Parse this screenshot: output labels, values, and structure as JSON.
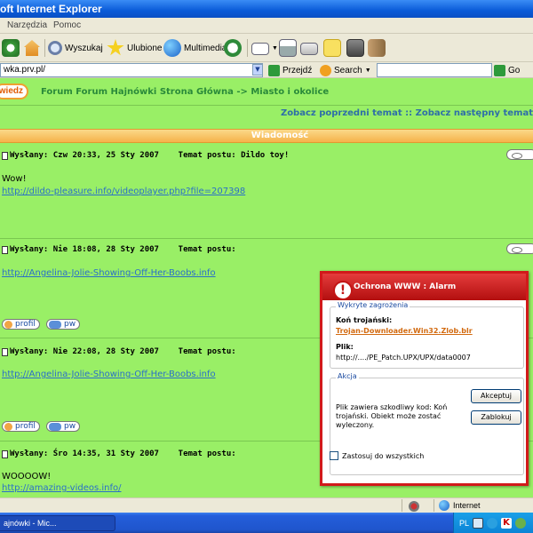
{
  "window": {
    "title": "oft Internet Explorer"
  },
  "menu": {
    "items": [
      "Narzędzia",
      "Pomoc"
    ]
  },
  "toolbar": {
    "search_label": "Wyszukaj",
    "favorites_label": "Ulubione",
    "multimedia_label": "Multimedia"
  },
  "address": {
    "url": "wka.prv.pl/",
    "go_label": "Przejdź",
    "search_label": "Search",
    "go2_label": "Go"
  },
  "forum": {
    "login_label": "wiedz",
    "path": "Forum Forum Hajnówki Strona Główna -> Miasto i okolice",
    "topic_nav": "Zobacz poprzedni temat :: Zobacz następny temat",
    "header": "Wiadomość"
  },
  "posts": [
    {
      "header": "Wysłany: Czw 20:33, 25 Sty 2007    Temat postu: Dildo toy!",
      "body": "Wow!",
      "link": "http://dildo-pleasure.info/videoplayer.php?file=207398"
    },
    {
      "header": "Wysłany: Nie 18:08, 28 Sty 2007    Temat postu:",
      "body": "",
      "link": "http://Angelina-Jolie-Showing-Off-Her-Boobs.info"
    },
    {
      "header": "Wysłany: Nie 22:08, 28 Sty 2007    Temat postu:",
      "body": "",
      "link": "http://Angelina-Jolie-Showing-Off-Her-Boobs.info"
    },
    {
      "header": "Wysłany: Śro 14:35, 31 Sty 2007    Temat postu:",
      "body": "WOOOOW!",
      "link": "http://amazing-videos.info/"
    }
  ],
  "post_buttons": {
    "profile": "profil",
    "pm": "pw"
  },
  "alarm": {
    "title": "Ochrona WWW : Alarm",
    "detected_legend": "Wykryte zagrożenia",
    "trojan_label": "Koń trojański:",
    "trojan_name": "Trojan-Downloader.Win32.Zlob.blr",
    "file_label": "Plik:",
    "file_path": "http://..../PE_Patch.UPX/UPX/data0007",
    "action_legend": "Akcja",
    "message_lines": [
      "Plik zawiera szkodliwy kod: Koń",
      "trojański. Obiekt może zostać",
      "wyleczony."
    ],
    "accept_label": "Akceptuj",
    "block_label": "Zablokuj",
    "apply_all_label": "Zastosuj do wszystkich"
  },
  "status": {
    "zone": "Internet"
  },
  "taskbar": {
    "item": "ajnówki - Mic...",
    "lang": "PL"
  },
  "colors": {
    "page_bg": "#99ef66",
    "alarm_red": "#d11a1a",
    "link": "#2a70c8"
  }
}
